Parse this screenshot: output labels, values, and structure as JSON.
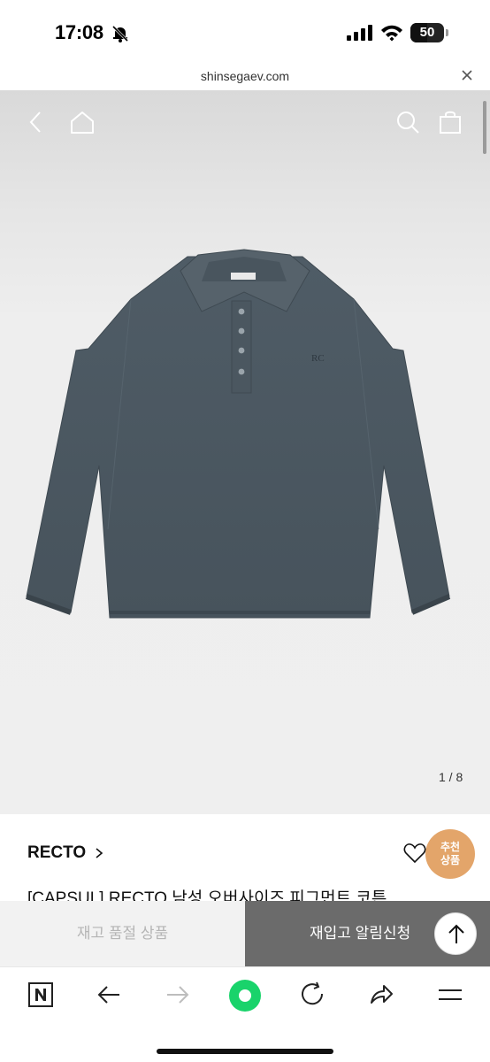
{
  "status_bar": {
    "time": "17:08",
    "battery": "50",
    "battery_level": 0.5,
    "icons": [
      "bell-off-icon",
      "signal-icon",
      "wifi-icon",
      "battery-icon"
    ]
  },
  "url_bar": {
    "domain": "shinsegaev.com",
    "icons": [
      "close-icon"
    ]
  },
  "hero": {
    "icons": [
      "back-icon",
      "home-icon",
      "search-icon",
      "shopping-bag-icon"
    ],
    "image": "dark grey long-sleeve polo shirt",
    "pager": "1 / 8"
  },
  "product": {
    "brand": "RECTO",
    "badge_line1": "추천",
    "badge_line2": "상품",
    "title": "[CAPSUL] RECTO 남성 오버사이즈 피그먼트 코튼",
    "icons": [
      "chevron-right-icon",
      "heart-icon"
    ]
  },
  "actions": {
    "soldout": "재고 품절 상품",
    "notify": "재입고 알림신청",
    "icons": [
      "arrow-up-icon"
    ]
  },
  "toolbar": {
    "icons": [
      "naver-n-icon",
      "back-arrow-icon",
      "forward-arrow-icon",
      "green-dot-icon",
      "refresh-icon",
      "share-icon",
      "menu-icon"
    ]
  },
  "colors": {
    "badge": "#e3a56a",
    "notify_bg": "#6b6b6b",
    "soldout_bg": "#f2f2f2",
    "green_button": "#19d36b",
    "shirt": "#4c5a64"
  }
}
